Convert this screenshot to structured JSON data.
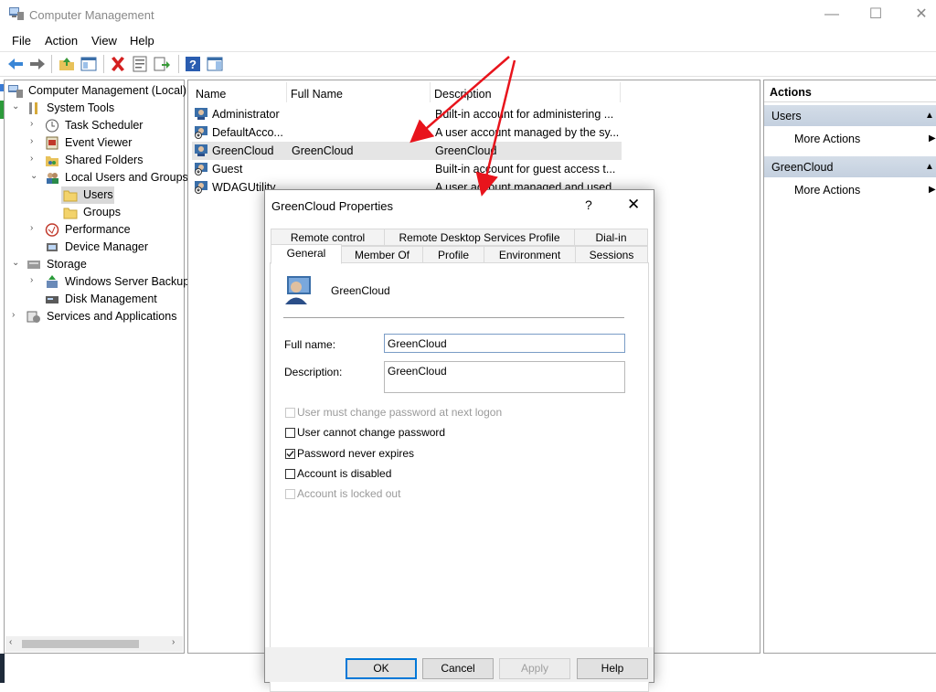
{
  "window": {
    "title": "Computer Management",
    "minimize_glyph": "—",
    "maximize_glyph": "☐",
    "close_glyph": "✕"
  },
  "menu": [
    "File",
    "Action",
    "View",
    "Help"
  ],
  "toolbar_icons": [
    "back-icon",
    "forward-icon",
    "up-folder-icon",
    "show-hide-tree-icon",
    "delete-icon",
    "properties-icon",
    "export-list-icon",
    "help-icon",
    "show-action-pane-icon"
  ],
  "tree": {
    "items": [
      {
        "label": "Computer Management (Local)"
      },
      {
        "label": "System Tools"
      },
      {
        "label": "Task Scheduler"
      },
      {
        "label": "Event Viewer"
      },
      {
        "label": "Shared Folders"
      },
      {
        "label": "Local Users and Groups"
      },
      {
        "label": "Users"
      },
      {
        "label": "Groups"
      },
      {
        "label": "Performance"
      },
      {
        "label": "Device Manager"
      },
      {
        "label": "Storage"
      },
      {
        "label": "Windows Server Backup"
      },
      {
        "label": "Disk Management"
      },
      {
        "label": "Services and Applications"
      }
    ]
  },
  "list": {
    "columns": [
      "Name",
      "Full Name",
      "Description"
    ],
    "rows": [
      {
        "name": "Administrator",
        "full_name": "",
        "description": "Built-in account for administering ..."
      },
      {
        "name": "DefaultAcco...",
        "full_name": "",
        "description": "A user account managed by the sy..."
      },
      {
        "name": "GreenCloud",
        "full_name": "GreenCloud",
        "description": "GreenCloud"
      },
      {
        "name": "Guest",
        "full_name": "",
        "description": "Built-in account for guest access t..."
      },
      {
        "name": "WDAGUtility...",
        "full_name": "",
        "description": "A user account managed and used..."
      }
    ]
  },
  "actions": {
    "header": "Actions",
    "groups": [
      {
        "label": "Users",
        "items": [
          "More Actions"
        ]
      },
      {
        "label": "GreenCloud",
        "items": [
          "More Actions"
        ]
      }
    ]
  },
  "dialog": {
    "title": "GreenCloud Properties",
    "help_glyph": "?",
    "close_glyph": "✕",
    "tabs_row1": [
      "Remote control",
      "Remote Desktop Services Profile",
      "Dial-in"
    ],
    "tabs_row2": [
      "General",
      "Member Of",
      "Profile",
      "Environment",
      "Sessions"
    ],
    "user_name": "GreenCloud",
    "full_name_label": "Full name:",
    "full_name_value": "GreenCloud",
    "description_label": "Description:",
    "description_value": "GreenCloud",
    "checkboxes": [
      {
        "label": "User must change password at next logon",
        "checked": false,
        "disabled": true
      },
      {
        "label": "User cannot change password",
        "checked": false,
        "disabled": false
      },
      {
        "label": "Password never expires",
        "checked": true,
        "disabled": false
      },
      {
        "label": "Account is disabled",
        "checked": false,
        "disabled": false
      },
      {
        "label": "Account is locked out",
        "checked": false,
        "disabled": true
      }
    ],
    "buttons": {
      "ok": "OK",
      "cancel": "Cancel",
      "apply": "Apply",
      "help": "Help"
    }
  },
  "colors": {
    "selection": "#d9d9d9",
    "action_group": "#c9d4e2",
    "annotation_arrow": "#e8141c",
    "focus_border": "#0078d7"
  }
}
